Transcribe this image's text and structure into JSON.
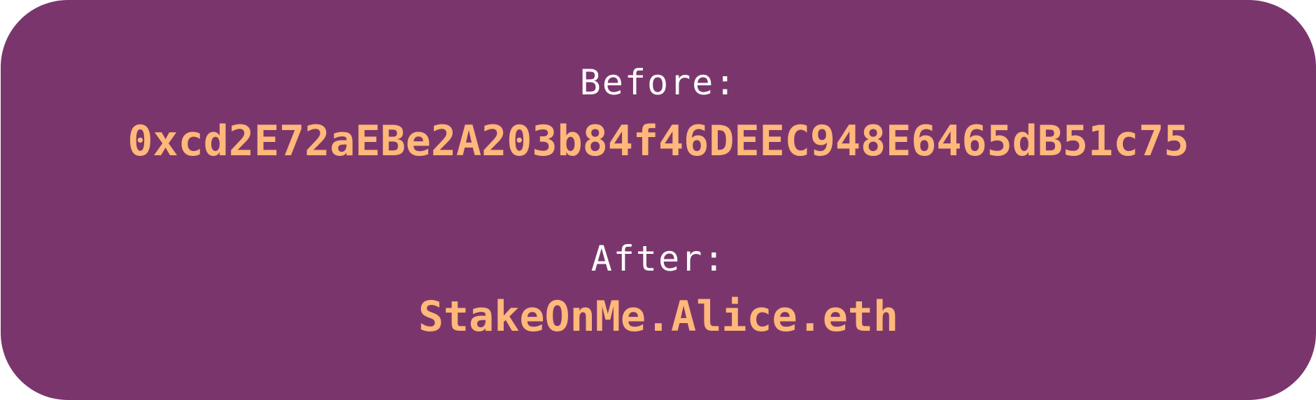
{
  "colors": {
    "card_background": "#7a366c",
    "label_text": "#ffffff",
    "value_text": "#ffb87a"
  },
  "before": {
    "label": "Before:",
    "value": "0xcd2E72aEBe2A203b84f46DEEC948E6465dB51c75"
  },
  "after": {
    "label": "After:",
    "value": "StakeOnMe.Alice.eth"
  }
}
